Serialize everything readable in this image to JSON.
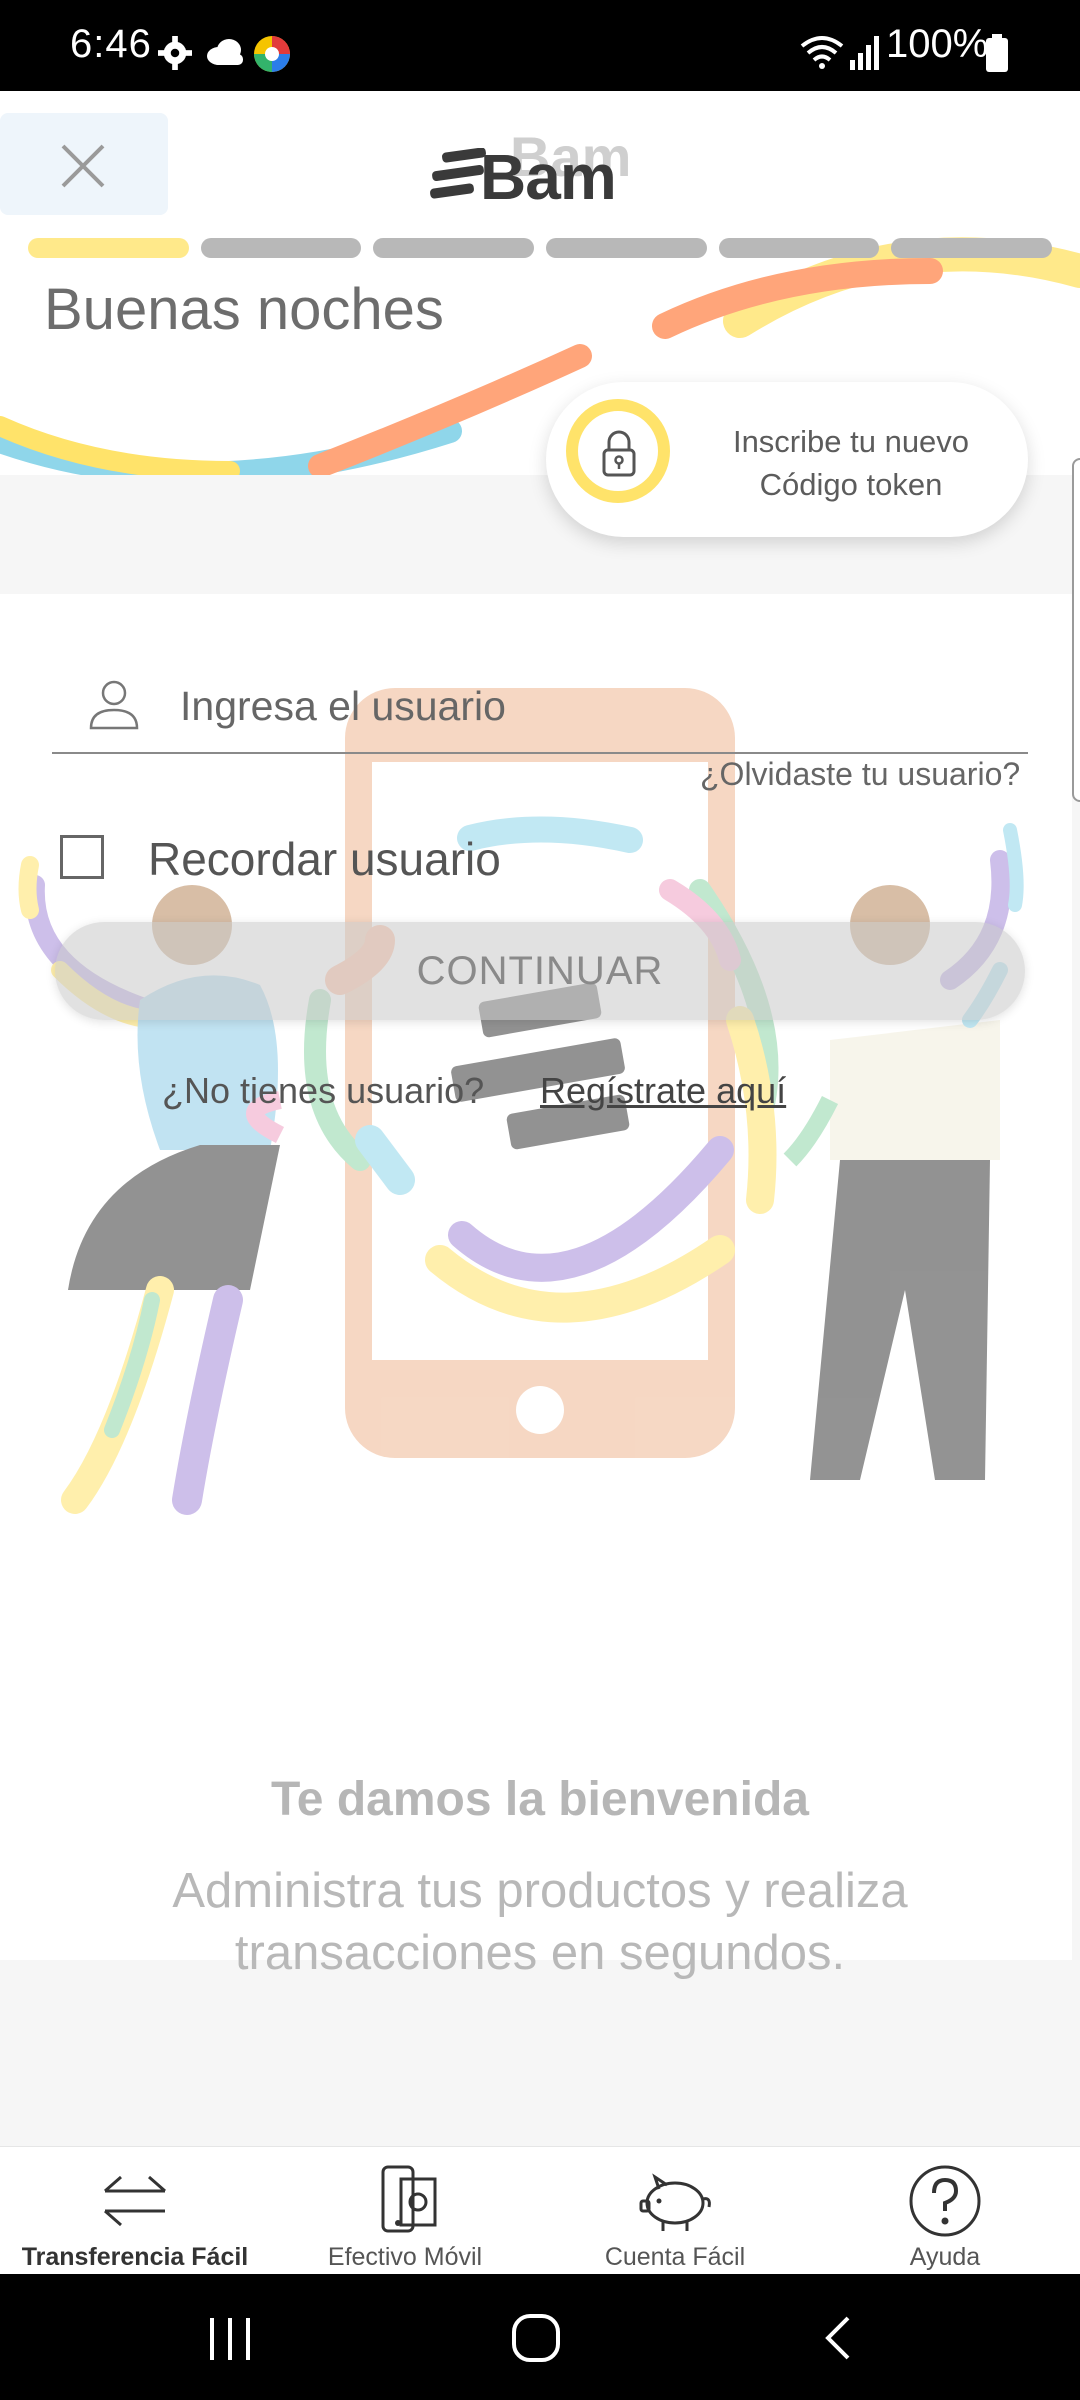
{
  "status_bar": {
    "time": "6:46",
    "battery": "100%"
  },
  "header": {
    "logo": "Bam",
    "greeting": "Buenas noches",
    "progress": {
      "total_steps": 6,
      "current_step": 1
    }
  },
  "token_card": {
    "line1": "Inscribe tu nuevo",
    "line2": "Código token"
  },
  "form": {
    "user_placeholder": "Ingresa el usuario",
    "forgot_user": "¿Olvidaste tu usuario?",
    "remember_label": "Recordar usuario",
    "continue_label": "CONTINUAR",
    "no_user_text": "¿No tienes usuario?",
    "register_link": "Regístrate aquí"
  },
  "welcome": {
    "title": "Te damos la bienvenida",
    "subtitle": "Administra tus productos y realiza transacciones en segundos."
  },
  "bottom_nav": [
    {
      "label": "Transferencia Fácil",
      "icon": "transfer-arrows-icon",
      "active": true
    },
    {
      "label": "Efectivo Móvil",
      "icon": "mobile-cash-icon",
      "active": false
    },
    {
      "label": "Cuenta Fácil",
      "icon": "piggy-bank-icon",
      "active": false
    },
    {
      "label": "Ayuda",
      "icon": "help-circle-icon",
      "active": false
    }
  ],
  "colors": {
    "accent_yellow": "#ffe36a",
    "accent_orange": "#ffa57a",
    "accent_blue": "#8fd6ea",
    "accent_purple": "#cdb6ea",
    "accent_green": "#b6e3c8"
  }
}
